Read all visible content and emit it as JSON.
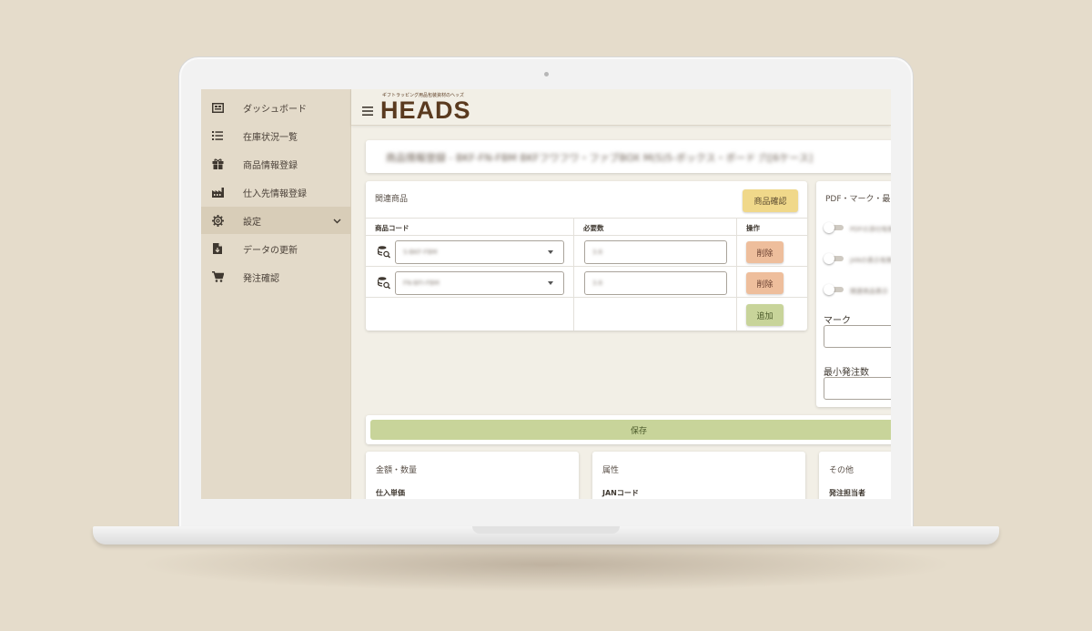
{
  "colors": {
    "background": "#e5dccb",
    "sidebar": "#e3dac9",
    "sidebar_active": "#d8cdb8",
    "brand": "#5a3a1f",
    "confirm_button": "#f0d88a",
    "delete_button": "#eebe9c",
    "add_button": "#c8d49a",
    "save_button": "#c8d49a"
  },
  "sidebar": {
    "items": [
      {
        "label": "ダッシュボード",
        "icon": "dashboard-icon"
      },
      {
        "label": "在庫状況一覧",
        "icon": "list-icon"
      },
      {
        "label": "商品情報登録",
        "icon": "gift-icon"
      },
      {
        "label": "仕入先情報登録",
        "icon": "factory-icon"
      },
      {
        "label": "設定",
        "icon": "gear-icon",
        "active": true,
        "expandable": true
      },
      {
        "label": "データの更新",
        "icon": "file-update-icon"
      },
      {
        "label": "発注確認",
        "icon": "cart-icon"
      }
    ]
  },
  "header": {
    "tagline": "ギフトラッピング用品包装資材のヘッズ",
    "logo": "HEADS",
    "menu_icon": "hamburger-icon"
  },
  "page_title": "商品情報登録 - BKF-FN-FBM BKFフワフワ・ファブBOX M(S)5-ボックス・ボード 穴[6ケース]",
  "related": {
    "heading": "関連商品",
    "confirm_label": "商品確認",
    "columns": [
      "商品コード",
      "必要数",
      "操作"
    ],
    "rows": [
      {
        "code": "S-BKF-FBM",
        "qty": "3.6",
        "delete_label": "削除"
      },
      {
        "code": "FN-BFI-FBM",
        "qty": "3.6",
        "delete_label": "削除"
      }
    ],
    "add_label": "追加"
  },
  "right_panel": {
    "heading": "PDF・マーク・最",
    "toggles": [
      {
        "label": "PDFの添付有無",
        "on": false
      },
      {
        "label": "JANの表示有無",
        "on": false
      },
      {
        "label": "関連商品表示",
        "on": false
      }
    ],
    "mark_label": "マーク",
    "mark_value": "",
    "min_order_label": "最小発注数",
    "min_order_value": ""
  },
  "save_label": "保存",
  "bottom_cards": [
    {
      "title": "金額・数量",
      "first_field": "仕入単価"
    },
    {
      "title": "属性",
      "first_field": "JANコード"
    },
    {
      "title": "その他",
      "first_field": "発注担当者"
    }
  ]
}
